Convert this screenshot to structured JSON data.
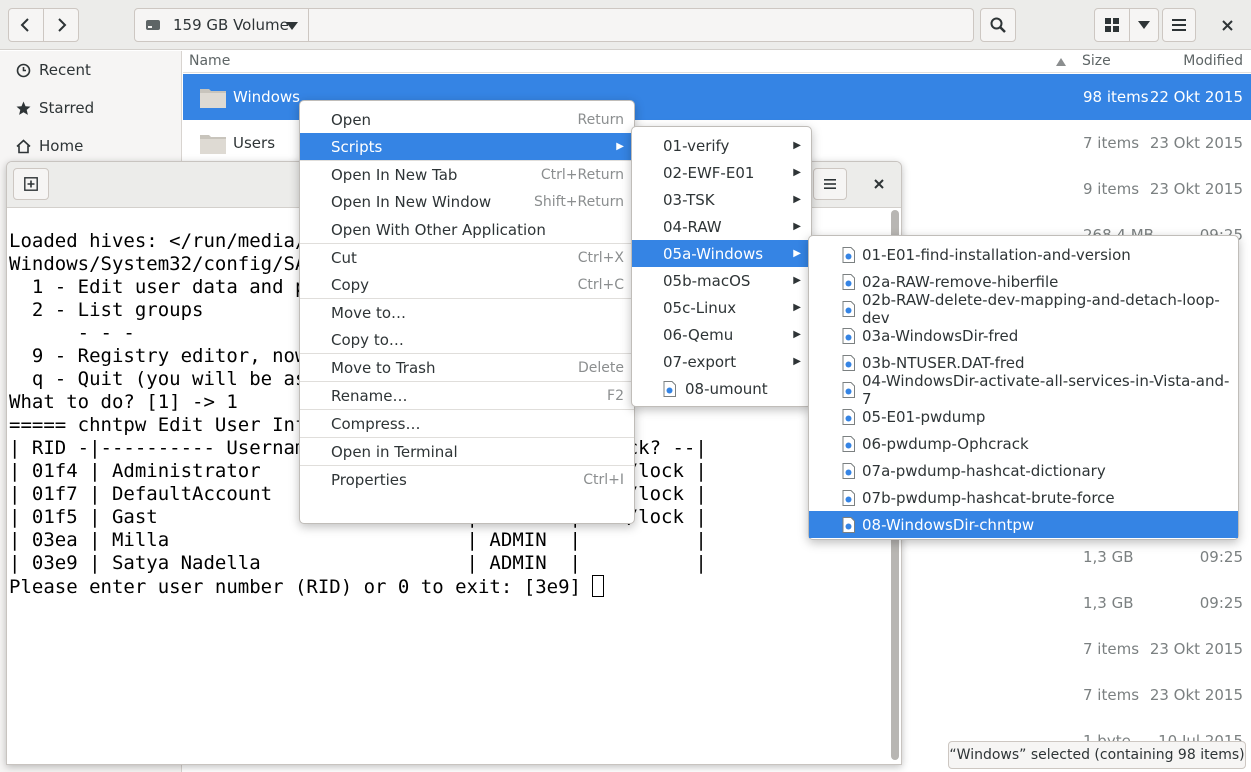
{
  "header": {
    "back_icon": "go-previous-icon",
    "forward_icon": "go-next-icon",
    "location": "159 GB Volume"
  },
  "sidebar": {
    "items": [
      {
        "label": "Recent",
        "icon": "clock-icon"
      },
      {
        "label": "Starred",
        "icon": "star-icon"
      },
      {
        "label": "Home",
        "icon": "home-icon"
      }
    ]
  },
  "columns": {
    "name": "Name",
    "size": "Size",
    "modified": "Modified"
  },
  "files": [
    {
      "name": "Windows",
      "size": "98 items",
      "modified": "22 Okt 2015",
      "selected": true
    },
    {
      "name": "Users",
      "size": "7 items",
      "modified": "23 Okt 2015"
    },
    {
      "name": "",
      "size": "9 items",
      "modified": "23 Okt 2015"
    },
    {
      "name": "",
      "size": "268,4 MB",
      "modified": "09:25"
    },
    {
      "name": "",
      "size": "1,3 GB",
      "modified": "09:25"
    },
    {
      "name": "",
      "size": "1,3 GB",
      "modified": "09:25"
    },
    {
      "name": "",
      "size": "7 items",
      "modified": "23 Okt 2015"
    },
    {
      "name": "",
      "size": "7 items",
      "modified": "23 Okt 2015"
    },
    {
      "name": "",
      "size": "1 byte",
      "modified": "10 Jul 2015"
    }
  ],
  "status": "“Windows” selected  (containing 98 items)",
  "terminal": {
    "lines": [
      "Loaded hives: </run/media/l",
      "Windows/System32/config/SAM",
      "",
      "  1 - Edit user data and pa",
      "  2 - List groups",
      "      - - -",
      "  9 - Registry editor, now ",
      "  q - Quit (you will be ask                    ve)",
      "",
      "",
      "What to do? [1] -> 1",
      "",
      "",
      "===== chntpw Edit User Info & Passwords ====",
      "",
      "| RID -|---------- Username ------------| Admin? |- Lock? --|",
      "| 01f4 | Administrator                  | ADMIN  | dis/lock |",
      "| 01f7 | DefaultAccount                 |        | dis/lock |",
      "| 01f5 | Gast                           |        | dis/lock |",
      "| 03ea | Milla                          | ADMIN  |          |",
      "| 03e9 | Satya Nadella                  | ADMIN  |          |",
      ""
    ],
    "prompt": "Please enter user number (RID) or 0 to exit: [3e9] "
  },
  "context_menu": {
    "items": [
      {
        "label": "Open",
        "accel": "Return"
      },
      {
        "label": "Scripts",
        "submenu": true,
        "highlighted": true
      },
      {
        "label": "Open In New Tab",
        "accel": "Ctrl+Return"
      },
      {
        "label": "Open In New Window",
        "accel": "Shift+Return"
      },
      {
        "label": "Open With Other Application",
        "accel": ""
      },
      {
        "label": "Cut",
        "accel": "Ctrl+X"
      },
      {
        "label": "Copy",
        "accel": "Ctrl+C"
      },
      {
        "label": "Move to…",
        "accel": ""
      },
      {
        "label": "Copy to…",
        "accel": ""
      },
      {
        "label": "Move to Trash",
        "accel": "Delete"
      },
      {
        "label": "Rename…",
        "accel": "F2"
      },
      {
        "label": "Compress…",
        "accel": ""
      },
      {
        "label": "Open in Terminal",
        "accel": ""
      },
      {
        "label": "Properties",
        "accel": "Ctrl+I"
      }
    ]
  },
  "scripts_menu": {
    "items": [
      {
        "label": "01-verify",
        "submenu": true
      },
      {
        "label": "02-EWF-E01",
        "submenu": true
      },
      {
        "label": "03-TSK",
        "submenu": true
      },
      {
        "label": "04-RAW",
        "submenu": true
      },
      {
        "label": "05a-Windows",
        "submenu": true,
        "highlighted": true
      },
      {
        "label": "05b-macOS",
        "submenu": true
      },
      {
        "label": "05c-Linux",
        "submenu": true
      },
      {
        "label": "06-Qemu",
        "submenu": true
      },
      {
        "label": "07-export",
        "submenu": true
      },
      {
        "label": "08-umount",
        "submenu": false
      }
    ]
  },
  "windows_menu": {
    "items": [
      {
        "label": "01-E01-find-installation-and-version"
      },
      {
        "label": "02a-RAW-remove-hiberfile"
      },
      {
        "label": "02b-RAW-delete-dev-mapping-and-detach-loop-dev"
      },
      {
        "label": "03a-WindowsDir-fred"
      },
      {
        "label": "03b-NTUSER.DAT-fred"
      },
      {
        "label": "04-WindowsDir-activate-all-services-in-Vista-and-7"
      },
      {
        "label": "05-E01-pwdump"
      },
      {
        "label": "06-pwdump-Ophcrack"
      },
      {
        "label": "07a-pwdump-hashcat-dictionary"
      },
      {
        "label": "07b-pwdump-hashcat-brute-force"
      },
      {
        "label": "08-WindowsDir-chntpw",
        "highlighted": true
      }
    ]
  }
}
